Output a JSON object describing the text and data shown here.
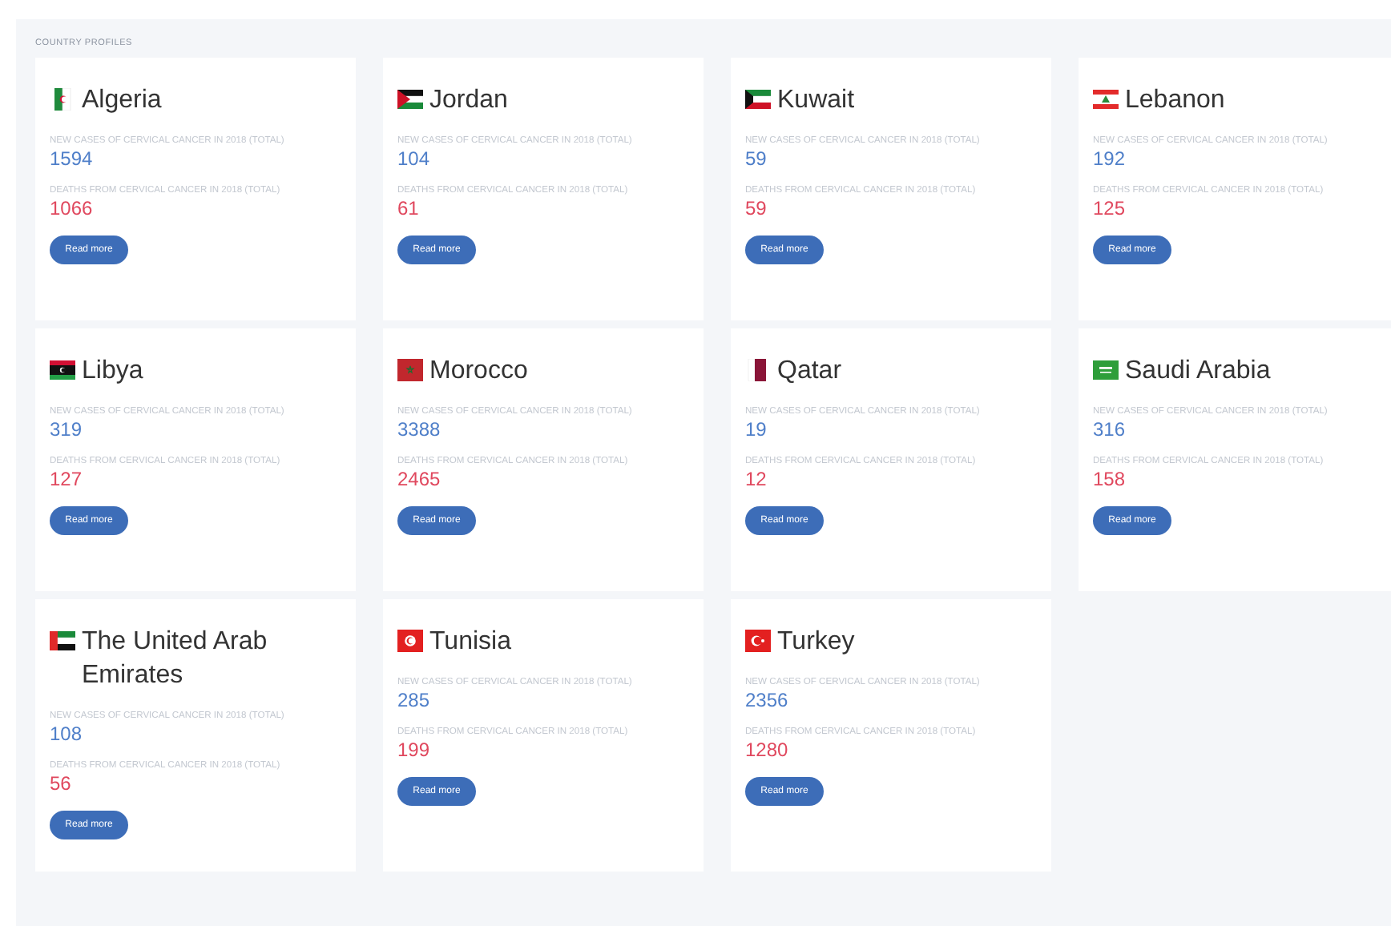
{
  "section_title": "COUNTRY PROFILES",
  "countries": [
    {
      "name": "Algeria",
      "new_label": "NEW CASES OF CERVICAL CANCER IN 2018 (TOTAL)",
      "new_cases": "1594",
      "deaths_label": "DEATHS FROM CERVICAL CANCER IN 2018 (TOTAL)",
      "deaths": "1066",
      "button": "Read more"
    },
    {
      "name": "Jordan",
      "new_label": "NEW CASES OF CERVICAL CANCER IN 2018 (TOTAL)",
      "new_cases": "104",
      "deaths_label": "DEATHS FROM CERVICAL CANCER IN 2018 (TOTAL)",
      "deaths": "61",
      "button": "Read more"
    },
    {
      "name": "Kuwait",
      "new_label": "NEW CASES OF CERVICAL CANCER IN 2018 (TOTAL)",
      "new_cases": "59",
      "deaths_label": "DEATHS FROM CERVICAL CANCER IN 2018 (TOTAL)",
      "deaths": "59",
      "button": "Read more"
    },
    {
      "name": "Lebanon",
      "new_label": "NEW CASES OF CERVICAL CANCER IN 2018 (TOTAL)",
      "new_cases": "192",
      "deaths_label": "DEATHS FROM CERVICAL CANCER IN 2018 (TOTAL)",
      "deaths": "125",
      "button": "Read more"
    },
    {
      "name": "Libya",
      "new_label": "NEW CASES OF CERVICAL CANCER IN 2018 (TOTAL)",
      "new_cases": "319",
      "deaths_label": "DEATHS FROM CERVICAL CANCER IN 2018 (TOTAL)",
      "deaths": "127",
      "button": "Read more"
    },
    {
      "name": "Morocco",
      "new_label": "NEW CASES OF CERVICAL CANCER IN 2018 (TOTAL)",
      "new_cases": "3388",
      "deaths_label": "DEATHS FROM CERVICAL CANCER IN 2018 (TOTAL)",
      "deaths": "2465",
      "button": "Read more"
    },
    {
      "name": "Qatar",
      "new_label": "NEW CASES OF CERVICAL CANCER IN 2018 (TOTAL)",
      "new_cases": "19",
      "deaths_label": "DEATHS FROM CERVICAL CANCER IN 2018 (TOTAL)",
      "deaths": "12",
      "button": "Read more"
    },
    {
      "name": "Saudi Arabia",
      "new_label": "NEW CASES OF CERVICAL CANCER IN 2018 (TOTAL)",
      "new_cases": "316",
      "deaths_label": "DEATHS FROM CERVICAL CANCER IN 2018 (TOTAL)",
      "deaths": "158",
      "button": "Read more"
    },
    {
      "name": "The United Arab Emirates",
      "new_label": "NEW CASES OF CERVICAL CANCER IN 2018 (TOTAL)",
      "new_cases": "108",
      "deaths_label": "DEATHS FROM CERVICAL CANCER IN 2018 (TOTAL)",
      "deaths": "56",
      "button": "Read more"
    },
    {
      "name": "Tunisia",
      "new_label": "NEW CASES OF CERVICAL CANCER IN 2018 (TOTAL)",
      "new_cases": "285",
      "deaths_label": "DEATHS FROM CERVICAL CANCER IN 2018 (TOTAL)",
      "deaths": "199",
      "button": "Read more"
    },
    {
      "name": "Turkey",
      "new_label": "NEW CASES OF CERVICAL CANCER IN 2018 (TOTAL)",
      "new_cases": "2356",
      "deaths_label": "DEATHS FROM CERVICAL CANCER IN 2018 (TOTAL)",
      "deaths": "1280",
      "button": "Read more"
    }
  ]
}
